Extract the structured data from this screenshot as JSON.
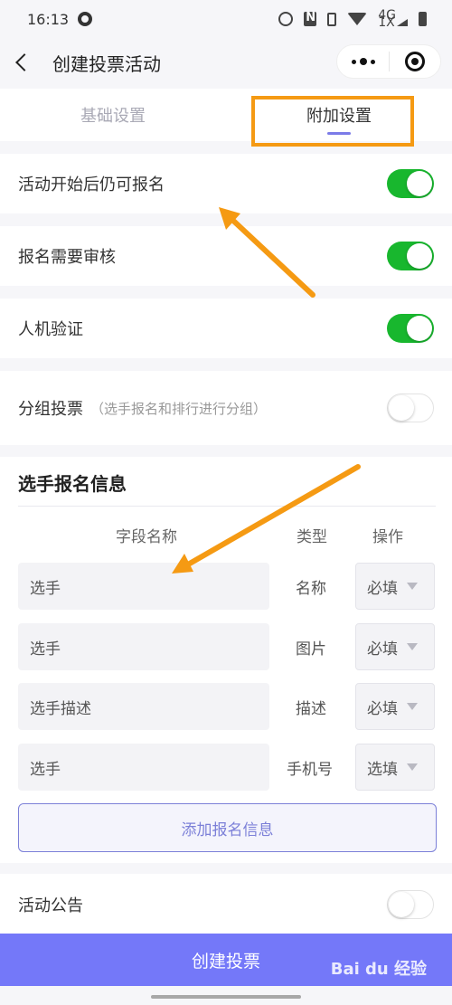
{
  "status_bar": {
    "time": "16:13",
    "icons": [
      "qq-icon",
      "alarm-icon",
      "nfc-icon",
      "vibrate-icon",
      "wifi-icon",
      "signal-icon",
      "battery-icon"
    ],
    "network_top": "4G",
    "network_bottom": "1X"
  },
  "nav": {
    "title": "创建投票活动",
    "back_icon": "chevron-left-icon",
    "more_icon": "more-dots-icon",
    "close_icon": "target-circle-icon"
  },
  "tabs": [
    {
      "label": "基础设置",
      "active": false
    },
    {
      "label": "附加设置",
      "active": true
    }
  ],
  "settings": [
    {
      "label": "活动开始后仍可报名",
      "enabled": true
    },
    {
      "label": "报名需要审核",
      "enabled": true
    },
    {
      "label": "人机验证",
      "enabled": true
    },
    {
      "label": "分组投票",
      "hint": "（选手报名和排行进行分组）",
      "enabled": false
    }
  ],
  "signup": {
    "title": "选手报名信息",
    "headers": {
      "name": "字段名称",
      "type": "类型",
      "action": "操作"
    },
    "fields": [
      {
        "name": "选手",
        "type": "名称",
        "requirement": "必填"
      },
      {
        "name": "选手",
        "type": "图片",
        "requirement": "必填"
      },
      {
        "name": "选手描述",
        "type": "描述",
        "requirement": "必填"
      },
      {
        "name": "选手",
        "type": "手机号",
        "requirement": "选填"
      }
    ],
    "add_label": "添加报名信息"
  },
  "announcement": {
    "label": "活动公告",
    "enabled": false
  },
  "create_button": "创建投票",
  "watermark": "Bai du 经验",
  "colors": {
    "accent": "#7478f9",
    "toggle_on": "#18b72e",
    "annotation": "#f59a13",
    "tab_indicator": "#7b7be8"
  }
}
